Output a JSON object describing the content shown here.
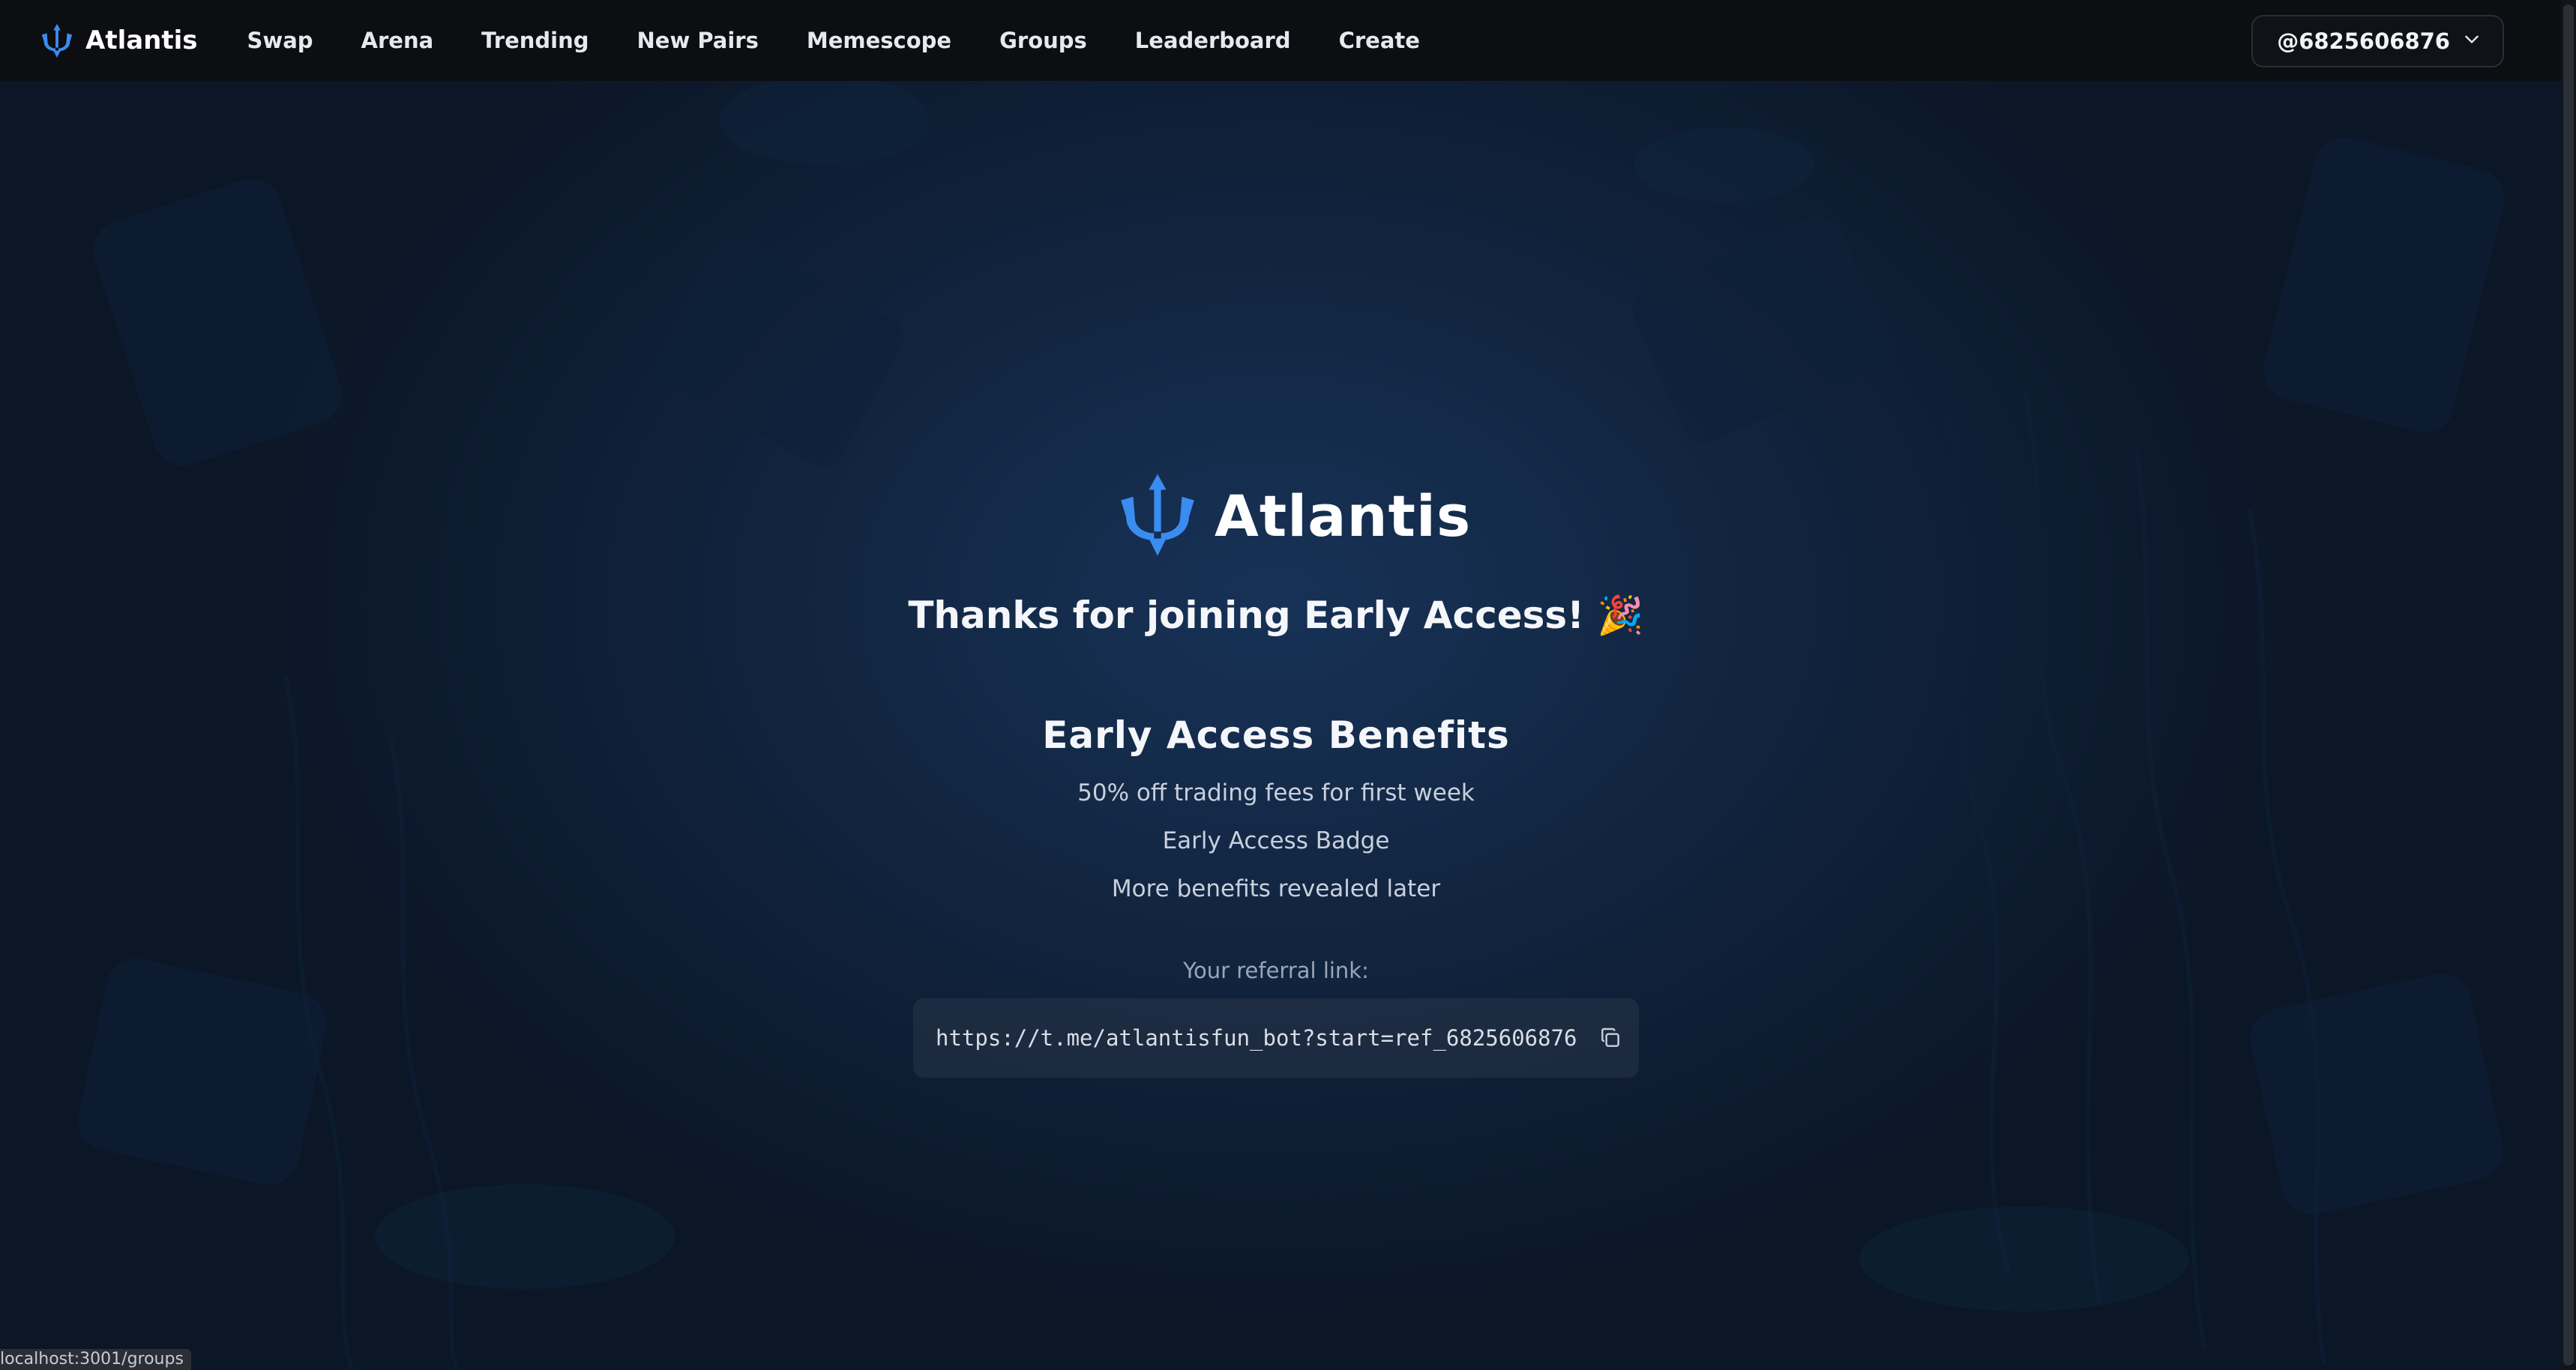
{
  "navbar": {
    "brand": "Atlantis",
    "items": [
      {
        "label": "Swap"
      },
      {
        "label": "Arena"
      },
      {
        "label": "Trending"
      },
      {
        "label": "New Pairs"
      },
      {
        "label": "Memescope"
      },
      {
        "label": "Groups"
      },
      {
        "label": "Leaderboard"
      },
      {
        "label": "Create"
      }
    ],
    "user": "@6825606876"
  },
  "hero": {
    "title": "Atlantis",
    "thanks": "Thanks for joining Early Access! 🎉"
  },
  "benefits": {
    "title": "Early Access Benefits",
    "items": [
      "50% off trading fees for first week",
      "Early Access Badge",
      "More benefits revealed later"
    ]
  },
  "referral": {
    "label": "Your referral link:",
    "link": "https://t.me/atlantisfun_bot?start=ref_6825606876"
  },
  "status_bar": {
    "url": "localhost:3001/groups"
  },
  "colors": {
    "accent": "#3b8cf0",
    "background": "#132845",
    "navbar": "#0c0e12"
  },
  "icons": {
    "logo": "trident-icon",
    "user_menu": "chevron-down-icon",
    "copy": "copy-icon"
  }
}
